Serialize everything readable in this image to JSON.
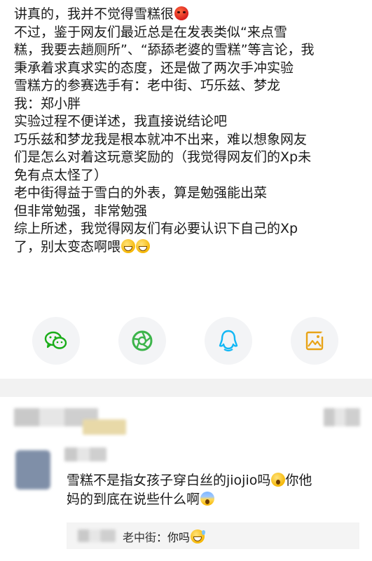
{
  "post": {
    "lines": [
      "讲真的，我并不觉得雪糕很",
      "不过，鉴于网友们最近总是在发表类似“来点雪",
      "糕，我要去趟厕所”、“舔舔老婆的雪糕”等言论，我",
      "秉承着求真求实的态度，还是做了两次手冲实验",
      "雪糕方的参赛选手有：老中街、巧乐兹、梦龙",
      "我：郑小胖",
      "实验过程不便详述，我直接说结论吧",
      "巧乐兹和梦龙我是根本就冲不出来，难以想象网友",
      "们是怎么对着这玩意奖励的（我觉得网友们的Xp未",
      "免有点太怪了）",
      "老中街得益于雪白的外表，算是勉强能出菜",
      "但非常勉强，非常勉强",
      "综上所述，我觉得网友们有必要认识下自己的Xp",
      "了，别太变态啊喂"
    ],
    "emoji_line1": "hot-face",
    "emoji_last_line": [
      "grimace-face",
      "grimace-face"
    ]
  },
  "share": {
    "buttons": [
      {
        "name": "wechat",
        "color": "#1aad19"
      },
      {
        "name": "moments",
        "color": "#3cb44a"
      },
      {
        "name": "qq",
        "color": "#12b7f5"
      },
      {
        "name": "save-image",
        "color": "#e8a317"
      }
    ]
  },
  "comment": {
    "text_line1": "雪糕不是指女孩子穿白丝的jiojio吗",
    "text_line2_a": "你他",
    "text_line2_b": "妈的到底在说些什么啊",
    "reply": {
      "author": "老中街",
      "separator": "：",
      "text": "你吗"
    }
  }
}
